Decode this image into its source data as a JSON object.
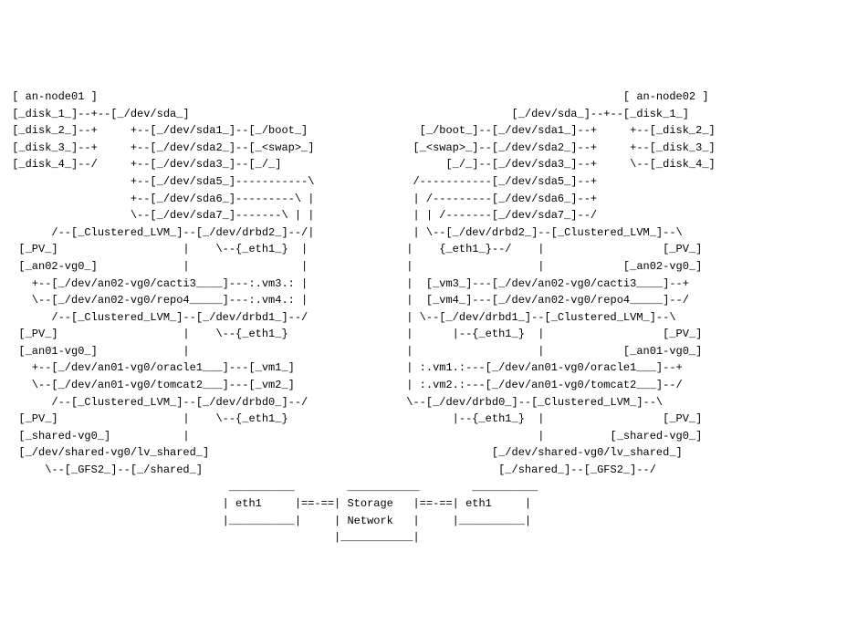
{
  "title_left": "an-node01",
  "title_right": "an-node02",
  "disks": [
    "disk_1",
    "disk_2",
    "disk_3",
    "disk_4"
  ],
  "devices": {
    "sda": "/dev/sda",
    "parts": [
      "/dev/sda1",
      "/dev/sda2",
      "/dev/sda3",
      "/dev/sda5",
      "/dev/sda6",
      "/dev/sda7"
    ],
    "mounts": {
      "boot": "/boot",
      "swap": "<swap>",
      "root": "/"
    },
    "drbd": [
      "/dev/drbd0",
      "/dev/drbd1",
      "/dev/drbd2"
    ],
    "lvs": [
      "/dev/an01-vg0/oracle1",
      "/dev/an01-vg0/tomcat2",
      "/dev/an02-vg0/cacti3",
      "/dev/an02-vg0/repo4",
      "/dev/shared-vg0/lv_shared"
    ]
  },
  "vms": [
    "vm1",
    "vm2",
    "vm3",
    "vm4"
  ],
  "labels": {
    "clustered_lvm": "Clustered_LVM",
    "pv": "PV",
    "vg_an01": "an01-vg0",
    "vg_an02": "an02-vg0",
    "vg_shared": "shared-vg0",
    "gfs2": "GFS2",
    "shared_mount": "/shared",
    "eth1_if": "eth1",
    "eth1_bond": "{_eth1_}",
    "storage_network": "Storage\nNetwork"
  },
  "ascii": " [ an-node01 ]                                                                                [ an-node02 ]\n [_disk_1_]--+--[_/dev/sda_]                                                 [_/dev/sda_]--+--[_disk_1_]\n [_disk_2_]--+     +--[_/dev/sda1_]--[_/boot_]                 [_/boot_]--[_/dev/sda1_]--+     +--[_disk_2_]\n [_disk_3_]--+     +--[_/dev/sda2_]--[_<swap>_]               [_<swap>_]--[_/dev/sda2_]--+     +--[_disk_3_]\n [_disk_4_]--/     +--[_/dev/sda3_]--[_/_]                         [_/_]--[_/dev/sda3_]--+     \\--[_disk_4_]\n                   +--[_/dev/sda5_]-----------\\               /-----------[_/dev/sda5_]--+\n                   +--[_/dev/sda6_]---------\\ |               | /---------[_/dev/sda6_]--+\n                   \\--[_/dev/sda7_]-------\\ | |               | | /-------[_/dev/sda7_]--/\n       /--[_Clustered_LVM_]--[_/dev/drbd2_]--/|               | \\--[_/dev/drbd2_]--[_Clustered_LVM_]--\\\n  [_PV_]                   |    \\--{_eth1_}  |               |    {_eth1_}--/    |                  [_PV_]\n  [_an02-vg0_]             |                 |               |                   |            [_an02-vg0_]\n    +--[_/dev/an02-vg0/cacti3____]---:.vm3.: |               |  [_vm3_]---[_/dev/an02-vg0/cacti3____]--+\n    \\--[_/dev/an02-vg0/repo4_____]---:.vm4.: |               |  [_vm4_]---[_/dev/an02-vg0/repo4_____]--/\n       /--[_Clustered_LVM_]--[_/dev/drbd1_]--/               | \\--[_/dev/drbd1_]--[_Clustered_LVM_]--\\\n  [_PV_]                   |    \\--{_eth1_}                  |      |--{_eth1_}  |                  [_PV_]\n  [_an01-vg0_]             |                                 |                   |            [_an01-vg0_]\n    +--[_/dev/an01-vg0/oracle1___]---[_vm1_]                 | :.vm1.:---[_/dev/an01-vg0/oracle1___]--+\n    \\--[_/dev/an01-vg0/tomcat2___]---[_vm2_]                 | :.vm2.:---[_/dev/an01-vg0/tomcat2___]--/\n       /--[_Clustered_LVM_]--[_/dev/drbd0_]--/               \\--[_/dev/drbd0_]--[_Clustered_LVM_]--\\\n  [_PV_]                   |    \\--{_eth1_}                         |--{_eth1_}  |                  [_PV_]\n  [_shared-vg0_]           |                                                     |          [_shared-vg0_]\n  [_/dev/shared-vg0/lv_shared_]                                           [_/dev/shared-vg0/lv_shared_]\n      \\--[_GFS2_]--[_/shared_]                                             [_/shared_]--[_GFS2_]--/\n                                  __________        ___________        __________\n                                 | eth1     |==-==| Storage   |==-==| eth1     |\n                                 |__________|     | Network   |     |__________|\n                                                  |___________|"
}
